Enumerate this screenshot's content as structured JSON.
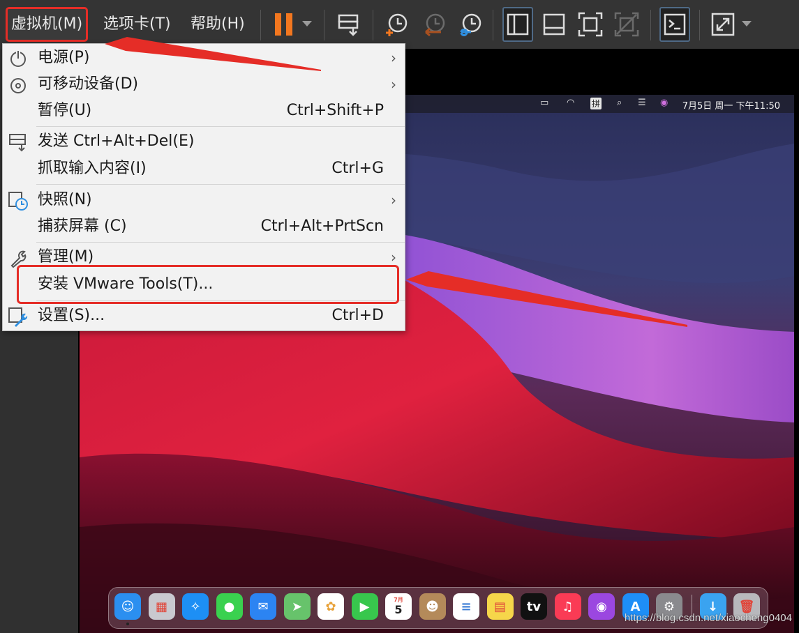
{
  "toolbar": {
    "menus": [
      "虚拟机(M)",
      "选项卡(T)",
      "帮助(H)"
    ]
  },
  "vm_menu": {
    "items": [
      {
        "label": "电源(P)",
        "shortcut": "",
        "submenu": true,
        "icon": "power-icon"
      },
      {
        "label": "可移动设备(D)",
        "shortcut": "",
        "submenu": true,
        "icon": "removable-device-icon"
      },
      {
        "label": "暂停(U)",
        "shortcut": "Ctrl+Shift+P",
        "submenu": false,
        "icon": ""
      },
      {
        "label": "发送 Ctrl+Alt+Del(E)",
        "shortcut": "",
        "submenu": false,
        "icon": "send-keys-icon"
      },
      {
        "label": "抓取输入内容(I)",
        "shortcut": "Ctrl+G",
        "submenu": false,
        "icon": ""
      },
      {
        "label": "快照(N)",
        "shortcut": "",
        "submenu": true,
        "icon": "snapshot-icon"
      },
      {
        "label": "捕获屏幕 (C)",
        "shortcut": "Ctrl+Alt+PrtScn",
        "submenu": false,
        "icon": ""
      },
      {
        "label": "管理(M)",
        "shortcut": "",
        "submenu": true,
        "icon": "wrench-icon"
      },
      {
        "label": "安装 VMware Tools(T)...",
        "shortcut": "",
        "submenu": false,
        "icon": ""
      },
      {
        "label": "设置(S)...",
        "shortcut": "Ctrl+D",
        "submenu": false,
        "icon": "settings-icon"
      }
    ],
    "submenu_glyph": "›"
  },
  "mac": {
    "menubar_ime": "拼",
    "clock": "7月5日 周一 下午11:50",
    "dock_apps": [
      {
        "name": "finder",
        "glyph": "☺",
        "bg": "#2b8ff0"
      },
      {
        "name": "launchpad",
        "glyph": "▦",
        "bg": "#c9c9cf"
      },
      {
        "name": "safari",
        "glyph": "✧",
        "bg": "#1d8ff5"
      },
      {
        "name": "messages",
        "glyph": "●",
        "bg": "#3ad14f"
      },
      {
        "name": "mail",
        "glyph": "✉",
        "bg": "#2c84f2"
      },
      {
        "name": "maps",
        "glyph": "➤",
        "bg": "#67c36b"
      },
      {
        "name": "photos",
        "glyph": "✿",
        "bg": "#ffffff"
      },
      {
        "name": "facetime",
        "glyph": "▶",
        "bg": "#38c74d"
      },
      {
        "name": "calendar",
        "glyph": "5",
        "bg": "#ffffff"
      },
      {
        "name": "contacts",
        "glyph": "☻",
        "bg": "#b48a5a"
      },
      {
        "name": "reminders",
        "glyph": "≡",
        "bg": "#ffffff"
      },
      {
        "name": "notes",
        "glyph": "▤",
        "bg": "#f6d64a"
      },
      {
        "name": "apple-tv",
        "glyph": "tv",
        "bg": "#111111"
      },
      {
        "name": "music",
        "glyph": "♫",
        "bg": "#fa3b55"
      },
      {
        "name": "podcasts",
        "glyph": "◉",
        "bg": "#9b47e0"
      },
      {
        "name": "app-store",
        "glyph": "A",
        "bg": "#1e8ef7"
      },
      {
        "name": "system-preferences",
        "glyph": "⚙",
        "bg": "#8a8a8e"
      },
      {
        "name": "downloads-folder",
        "glyph": "↓",
        "bg": "#3aa3f0"
      },
      {
        "name": "trash",
        "glyph": "🗑",
        "bg": "#b8b8bc"
      }
    ],
    "calendar_month": "7月"
  },
  "watermark": "https://blog.csdn.net/xiaocheng0404",
  "colors": {
    "annotation_red": "#e52d27",
    "pause_orange": "#f3771f",
    "menu_bg": "#f2f2f2"
  }
}
